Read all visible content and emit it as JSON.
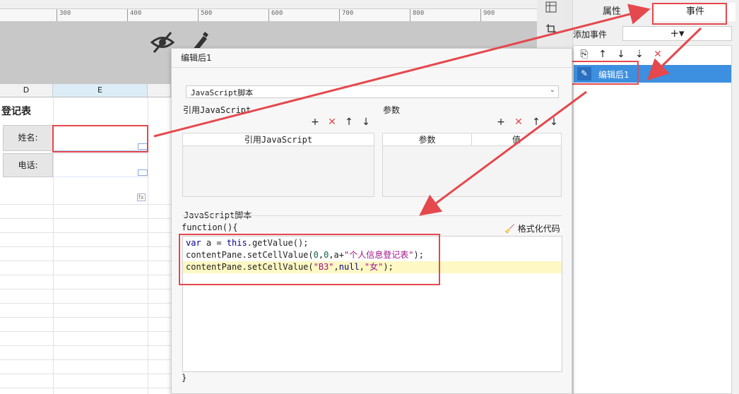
{
  "ruler": {
    "ticks": [
      "300",
      "400",
      "500",
      "600",
      "700",
      "800",
      "900"
    ]
  },
  "sheet": {
    "col_d": "D",
    "col_e": "E",
    "title_fragment": "登记表",
    "name_label": "姓名:",
    "phone_label": "电话:",
    "fx_marker": "fx"
  },
  "right_panel": {
    "tab_properties": "属性",
    "tab_events": "事件",
    "add_event_label": "添加事件",
    "add_icon": "+▾",
    "event_item": "编辑后1"
  },
  "dialog": {
    "title": "编辑后1",
    "type_select": "JavaScript脚本",
    "ref_js_title": "引用JavaScript",
    "param_title": "参数",
    "ref_js_col": "引用JavaScript",
    "param_col": "参数",
    "value_col": "值",
    "script_title": "JavaScript脚本",
    "function_header": "function(){",
    "format_code": "格式化代码",
    "closing_brace": "}",
    "code_lines": [
      "var a = this.getValue();",
      "contentPane.setCellValue(0,0,a+\"个人信息登记表\");",
      "contentPane.setCellValue(\"B3\",null,\"女\");"
    ]
  },
  "colors": {
    "annotation_red": "#e5484d",
    "selection_blue": "#3d8fe0",
    "highlight_line": "#fdf8c4"
  }
}
